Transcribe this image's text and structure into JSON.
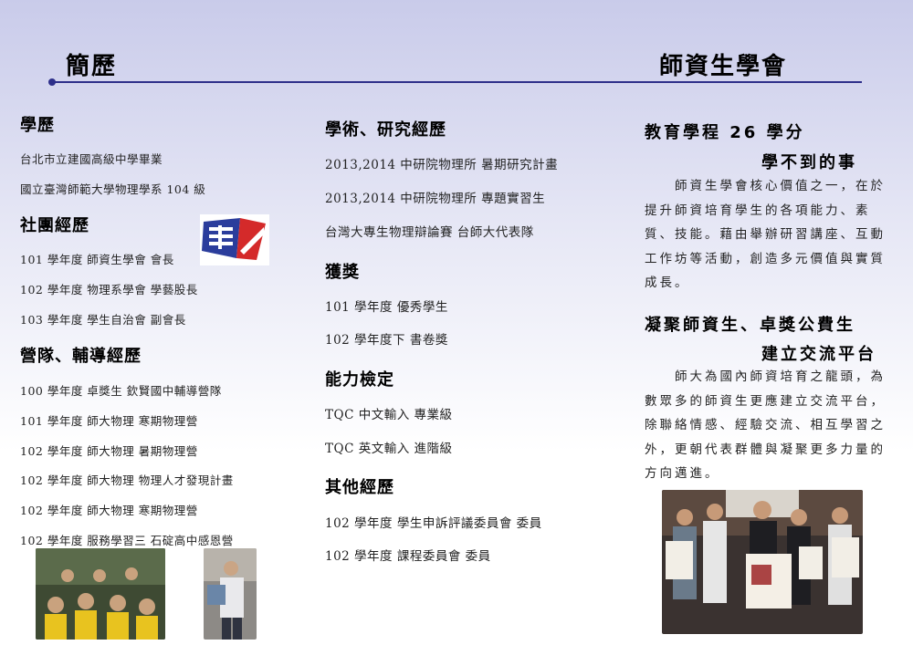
{
  "header": {
    "left_title": "簡歷",
    "right_title": "師資生學會"
  },
  "left_column": {
    "education": {
      "heading": "學歷",
      "items": [
        "台北市立建國高級中學畢業",
        "國立臺灣師範大學物理學系 104 級"
      ]
    },
    "clubs": {
      "heading": "社團經歷",
      "items": [
        "101 學年度 師資生學會 會長",
        "102 學年度 物理系學會 學藝股長",
        "103 學年度 學生自治會 副會長"
      ]
    },
    "camps": {
      "heading": "營隊、輔導經歷",
      "items": [
        "100 學年度 卓獎生 欽賢國中輔導營隊",
        "101 學年度 師大物理 寒期物理營",
        "102 學年度 師大物理 暑期物理營",
        "102 學年度 師大物理 物理人才發現計畫",
        "102 學年度 師大物理 寒期物理營",
        "102 學年度 服務學習三 石碇高中感恩營"
      ]
    }
  },
  "middle_column": {
    "research": {
      "heading": "學術、研究經歷",
      "items": [
        "2013,2014 中研院物理所 暑期研究計畫",
        "2013,2014 中研院物理所 專題實習生",
        "台灣大專生物理辯論賽 台師大代表隊"
      ]
    },
    "awards": {
      "heading": "獲獎",
      "items": [
        "101 學年度 優秀學生",
        "102 學年度下 書卷獎"
      ]
    },
    "certification": {
      "heading": "能力檢定",
      "items": [
        "TQC 中文輸入 專業級",
        "TQC 英文輸入 進階級"
      ]
    },
    "other": {
      "heading": "其他經歷",
      "items": [
        "102 學年度 學生申訴評議委員會 委員",
        "102 學年度 課程委員會 委員"
      ]
    }
  },
  "right_column": {
    "block1": {
      "heading_line1": "教育學程 26 學分",
      "heading_line2": "學不到的事",
      "body": "　　師資生學會核心價值之一，在於提升師資培育學生的各項能力、素質、技能。藉由舉辦研習講座、互動工作坊等活動，創造多元價值與實質成長。"
    },
    "block2": {
      "heading_line1": "凝聚師資生、卓獎公費生",
      "heading_line2": "建立交流平台",
      "body": "　　師大為國內師資培育之龍頭，為數眾多的師資生更應建立交流平台，除聯絡情感、經驗交流、相互學習之外，更朝代表群體與凝聚更多力量的方向邁進。"
    }
  },
  "colors": {
    "rule": "#2d2f8a",
    "logo_blue": "#2b3d9c",
    "logo_red": "#d42a2a"
  }
}
